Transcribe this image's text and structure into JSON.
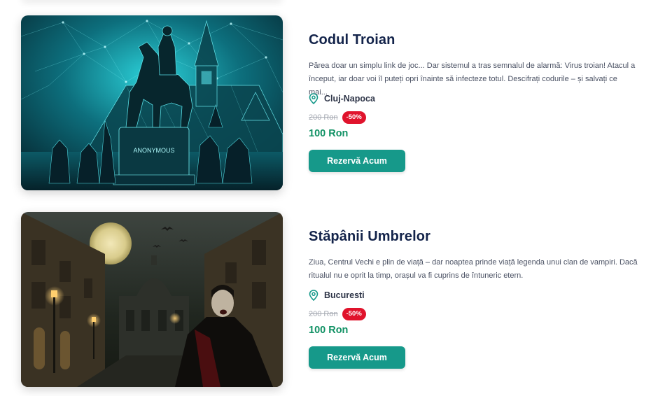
{
  "rooms": [
    {
      "title": "Codul Troian",
      "description": "Părea doar un simplu link de joc... Dar sistemul a tras semnalul de alarmă: Virus troian! Atacul a început, iar doar voi îl puteți opri înainte să infecteze totul. Descifrați codurile – și salvați ce mai...",
      "location": "Cluj-Napoca",
      "old_price": "200 Ron",
      "discount": "-50%",
      "price": "100 Ron",
      "button_label": "Rezervă Acum",
      "image_caption": "ANONYMOUS"
    },
    {
      "title": "Stăpânii Umbrelor",
      "description": "Ziua, Centrul Vechi e plin de viață – dar noaptea prinde viață legenda unui clan de vampiri. Dacă ritualul nu e oprit la timp, orașul va fi cuprins de întuneric etern.",
      "location": "Bucuresti",
      "old_price": "200 Ron",
      "discount": "-50%",
      "price": "100 Ron",
      "button_label": "Rezervă Acum"
    }
  ],
  "icons": {
    "location": "map-pin-icon"
  },
  "colors": {
    "title": "#13234a",
    "price": "#109164",
    "badge": "#e0132c",
    "button": "#16998a"
  }
}
